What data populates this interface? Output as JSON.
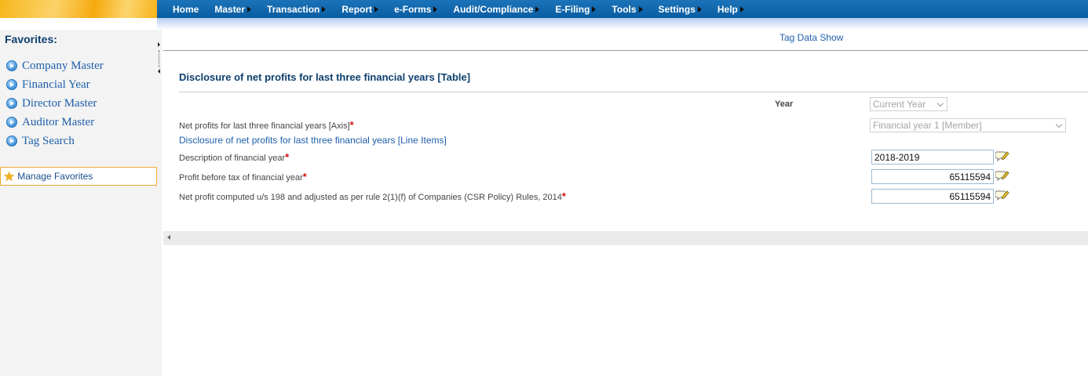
{
  "menu": {
    "items": [
      {
        "label": "Home",
        "arrow": false
      },
      {
        "label": "Master",
        "arrow": true
      },
      {
        "label": "Transaction",
        "arrow": true
      },
      {
        "label": "Report",
        "arrow": true
      },
      {
        "label": "e-Forms",
        "arrow": true
      },
      {
        "label": "Audit/Compliance",
        "arrow": true
      },
      {
        "label": "E-Filing",
        "arrow": true
      },
      {
        "label": "Tools",
        "arrow": true
      },
      {
        "label": "Settings",
        "arrow": true
      },
      {
        "label": "Help",
        "arrow": true
      }
    ]
  },
  "sidebar": {
    "title": "Favorites:",
    "items": [
      {
        "label": "Company Master",
        "icon": "arrow-circle-icon"
      },
      {
        "label": "Financial Year",
        "icon": "arrow-circle-icon"
      },
      {
        "label": "Director Master",
        "icon": "arrow-circle-icon"
      },
      {
        "label": "Auditor Master",
        "icon": "arrow-circle-icon"
      },
      {
        "label": "Tag Search",
        "icon": "arrow-circle-icon"
      }
    ],
    "manage_label": "Manage Favorites"
  },
  "main": {
    "tag_link": "Tag Data Show",
    "section_title": "Disclosure of net profits for last three financial years [Table]",
    "year_label": "Year",
    "year_select": "Current Year",
    "axis_label": "Net profits for last three financial years [Axis]",
    "axis_select": "Financial year 1 [Member]",
    "line_items_label": "Disclosure of net profits for last three financial years [Line Items]",
    "fields": [
      {
        "label": "Description of financial year",
        "value": "2018-2019",
        "align": "left"
      },
      {
        "label": "Profit before tax of financial year",
        "value": "65115594",
        "align": "right"
      },
      {
        "label": "Net profit computed u/s 198 and adjusted as per rule 2(1)(f) of Companies (CSR Policy) Rules, 2014",
        "value": "65115594",
        "align": "right"
      }
    ],
    "required_mark": "*"
  },
  "colors": {
    "menu_bar": "#0a5da2",
    "title_text": "#0e3f6e",
    "link_text": "#1f5faa",
    "required": "#d21010"
  }
}
